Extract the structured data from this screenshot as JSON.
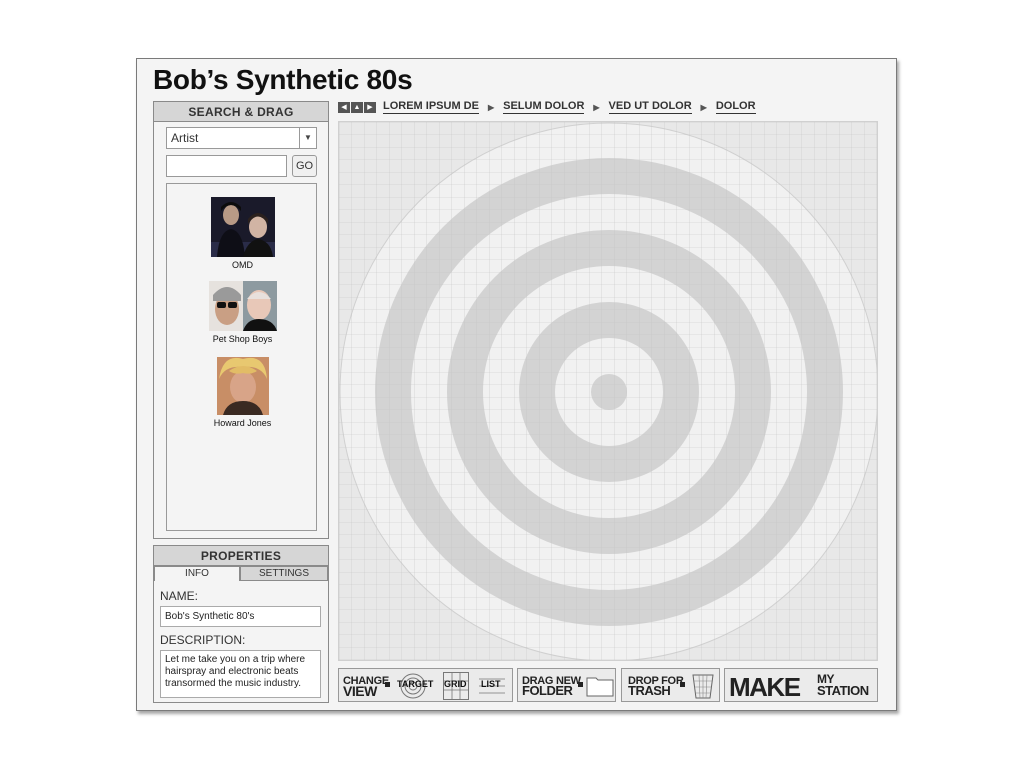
{
  "app": {
    "title": "Bob’s Synthetic 80s"
  },
  "search_panel": {
    "heading": "SEARCH & DRAG",
    "filter_selected": "Artist",
    "query_value": "",
    "go_label": "GO",
    "results": [
      {
        "name": "OMD"
      },
      {
        "name": "Pet Shop Boys"
      },
      {
        "name": "Howard Jones"
      }
    ]
  },
  "properties_panel": {
    "heading": "PROPERTIES",
    "tabs": [
      {
        "label": "INFO",
        "active": true
      },
      {
        "label": "SETTINGS",
        "active": false
      }
    ],
    "name_label": "NAME:",
    "name_value": "Bob's Synthetic 80's",
    "description_label": "DESCRIPTION:",
    "description_value": "Let me take you on a trip where hairspray and electronic beats transormed the music industry."
  },
  "breadcrumb": {
    "items": [
      "LOREM IPSUM DE",
      "SELUM DOLOR",
      "VED UT DOLOR",
      "DOLOR"
    ]
  },
  "toolbar": {
    "change_view_top": "CHANGE",
    "change_view_bottom": "VIEW",
    "view_options": [
      "TARGET",
      "GRID",
      "LIST"
    ],
    "drag_new_top": "DRAG NEW",
    "drag_new_bottom": "FOLDER",
    "drop_for_top": "DROP FOR",
    "drop_for_bottom": "TRASH",
    "make_label": "MAKE",
    "my_label": "MY",
    "station_label": "STATION"
  },
  "colors": {
    "ring_dark": "#d2d2d2",
    "ring_light": "#f1f1f1",
    "grid_bg": "#e8e8e8",
    "panel_header": "#d6d6d6"
  }
}
